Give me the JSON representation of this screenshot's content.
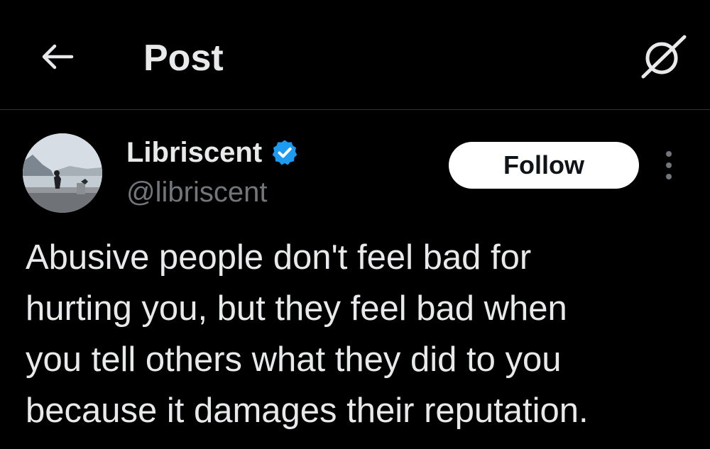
{
  "header": {
    "title": "Post",
    "back_icon": "arrow-left-icon",
    "grok_icon": "grok-slash-circle-icon"
  },
  "author": {
    "display_name": "Libriscent",
    "handle": "@libriscent",
    "verified": true,
    "verified_color": "#1d9bf0",
    "follow_label": "Follow",
    "more_icon": "more-vertical-icon"
  },
  "post": {
    "lines": [
      "Abusive people don't feel bad for",
      "hurting you, but they feel bad when",
      "you tell others what they did to you",
      "because it damages their reputation."
    ]
  },
  "colors": {
    "background": "#000000",
    "primary_text": "#e7e9ea",
    "secondary_text": "#71767b",
    "divider": "#2f3336"
  }
}
